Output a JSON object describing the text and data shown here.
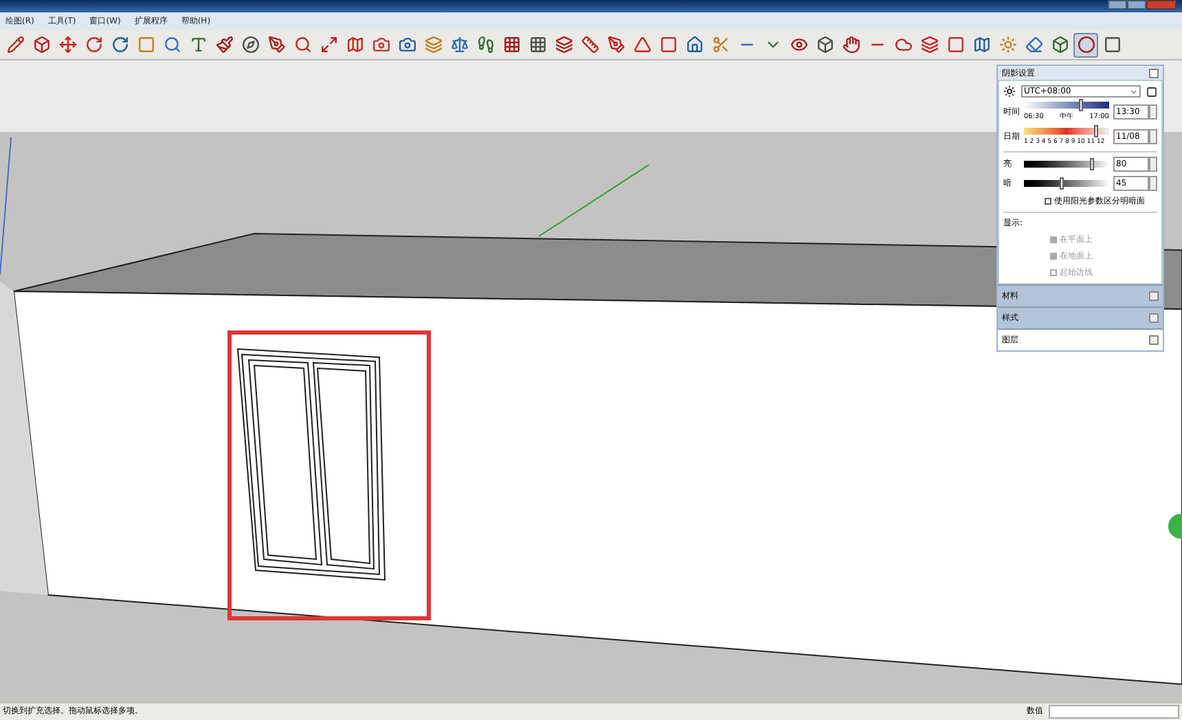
{
  "menu": [
    {
      "label": "绘图(R)"
    },
    {
      "label": "工具(T)"
    },
    {
      "label": "窗口(W)"
    },
    {
      "label": "扩展程序"
    },
    {
      "label": "帮助(H)"
    }
  ],
  "toolbar": [
    {
      "selected": false
    },
    {
      "selected": false
    },
    {
      "selected": false
    },
    {
      "selected": false
    },
    {
      "selected": false
    },
    {
      "selected": false
    },
    {
      "selected": false
    },
    {
      "selected": false
    },
    {
      "selected": false
    },
    {
      "selected": false
    },
    {
      "selected": false
    },
    {
      "selected": false
    },
    {
      "selected": false
    },
    {
      "selected": false
    },
    {
      "selected": false
    },
    {
      "selected": false
    },
    {
      "selected": false
    },
    {
      "selected": false
    },
    {
      "selected": false
    },
    {
      "selected": false
    },
    {
      "selected": false
    },
    {
      "selected": false
    },
    {
      "selected": false
    },
    {
      "selected": false
    },
    {
      "selected": false
    },
    {
      "selected": false
    },
    {
      "selected": false
    },
    {
      "selected": false
    },
    {
      "selected": false
    },
    {
      "selected": false
    },
    {
      "selected": false
    },
    {
      "selected": false
    },
    {
      "selected": false
    },
    {
      "selected": false
    },
    {
      "selected": false
    },
    {
      "selected": false
    },
    {
      "selected": false
    },
    {
      "selected": false
    },
    {
      "selected": false
    },
    {
      "selected": false
    },
    {
      "selected": false
    },
    {
      "selected": true
    },
    {
      "selected": false
    }
  ],
  "shadow_panel": {
    "title": "阴影设置",
    "timezone": "UTC+08:00",
    "time": {
      "label": "时间",
      "start": "06:30",
      "middle": "中午",
      "end": "17:00",
      "level": 0.67,
      "value": "13:30"
    },
    "date": {
      "label": "日期",
      "months": "1 2 3 4 5 6 7 8 9 10 11 12",
      "level": 0.85,
      "value": "11/08"
    },
    "light": {
      "label": "亮",
      "level": 0.8,
      "value": "80"
    },
    "dark": {
      "label": "暗",
      "level": 0.45,
      "value": "45"
    },
    "sun_option": {
      "label": "使用阳光参数区分明暗面",
      "checked": false
    },
    "display_label": "显示:",
    "display_options": [
      {
        "label": "在平面上",
        "checked": true,
        "disabled": true
      },
      {
        "label": "在地面上",
        "checked": true,
        "disabled": true
      },
      {
        "label": "起始边线",
        "checked": false,
        "disabled": true
      }
    ]
  },
  "collapsed_panels": [
    {
      "title": "材料",
      "selected": true
    },
    {
      "title": "样式",
      "selected": true
    },
    {
      "title": "图层",
      "selected": false
    }
  ],
  "status_bar": {
    "message": "切换到扩充选择。拖动鼠标选择多项。",
    "measure_label": "数值"
  }
}
